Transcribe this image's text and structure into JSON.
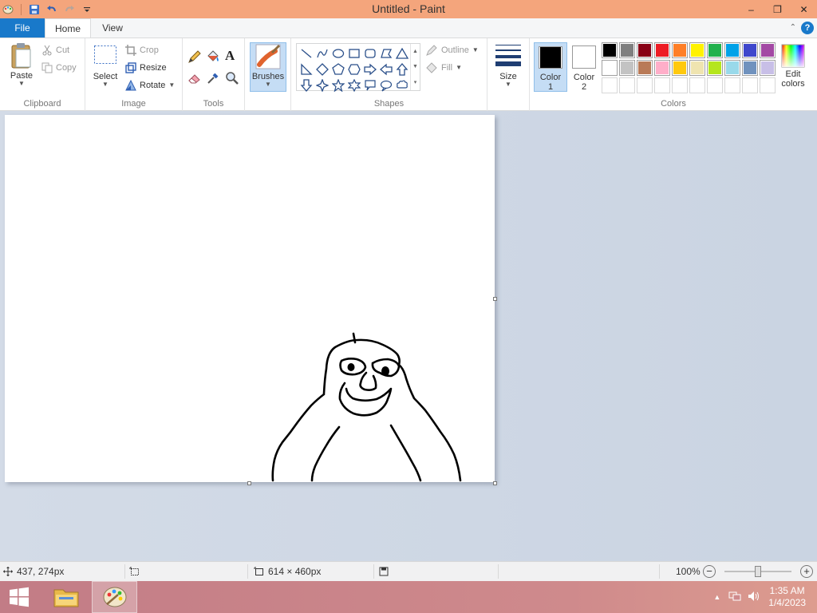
{
  "window": {
    "title": "Untitled - Paint",
    "controls": {
      "minimize": "–",
      "maximize": "❐",
      "close": "✕"
    }
  },
  "ribbon_tabs": {
    "file": "File",
    "home": "Home",
    "view": "View",
    "help": "?"
  },
  "clipboard": {
    "label": "Clipboard",
    "paste": "Paste",
    "cut": "Cut",
    "copy": "Copy"
  },
  "image": {
    "label": "Image",
    "select": "Select",
    "crop": "Crop",
    "resize": "Resize",
    "rotate": "Rotate"
  },
  "tools": {
    "label": "Tools"
  },
  "brushes": {
    "label": "Brushes"
  },
  "shapes": {
    "label": "Shapes",
    "outline": "Outline",
    "fill": "Fill"
  },
  "size": {
    "label": "Size"
  },
  "colors": {
    "label": "Colors",
    "color1_label": "Color",
    "color1_num": "1",
    "color2_label": "Color",
    "color2_num": "2",
    "color1": "#000000",
    "color2": "#ffffff",
    "edit_colors_1": "Edit",
    "edit_colors_2": "colors",
    "palette_row1": [
      "#000000",
      "#7f7f7f",
      "#880015",
      "#ed1c24",
      "#ff7f27",
      "#fff200",
      "#22b14c",
      "#00a2e8",
      "#3f48cc",
      "#a349a4"
    ],
    "palette_row2": [
      "#ffffff",
      "#c3c3c3",
      "#b97a57",
      "#ffaec9",
      "#ffc90e",
      "#efe4b0",
      "#b5e61d",
      "#99d9ea",
      "#7092be",
      "#c8bfe7"
    ]
  },
  "status": {
    "cursor_position": "437, 274px",
    "selection_size": "",
    "canvas_size": "614 × 460px",
    "zoom": "100%",
    "zoom_out": "−",
    "zoom_in": "+"
  },
  "taskbar": {
    "time": "1:35 AM",
    "date": "1/4/2023"
  }
}
